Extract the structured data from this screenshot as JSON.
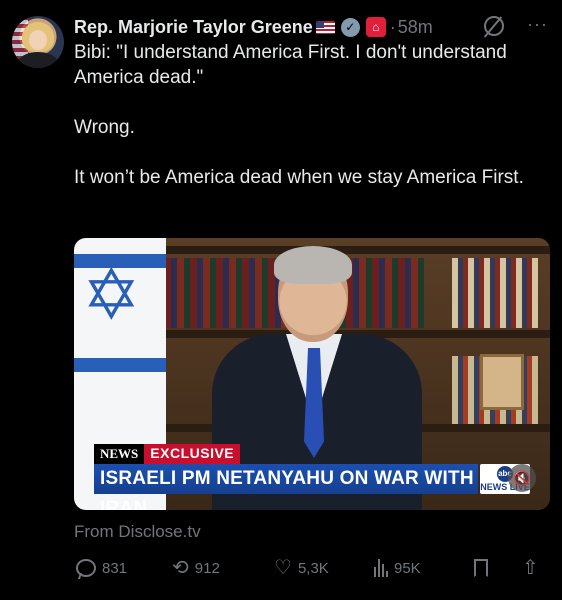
{
  "post": {
    "author_name": "Rep. Marjorie Taylor Greene",
    "timestamp_separator": "·",
    "time_ago": "58m",
    "paragraphs": [
      "Bibi: \"I understand America First. I don't understand America dead.\"",
      "Wrong.",
      "It won’t be America dead when we stay America First."
    ],
    "source": "From Disclose.tv"
  },
  "media": {
    "network_tag": "NEWS",
    "exclusive_tag": "EXCLUSIVE",
    "headline": "ISRAELI PM NETANYAHU ON WAR WITH IRAN",
    "logo_top": "abc",
    "logo_bottom": "NEWS LIVE"
  },
  "actions": {
    "replies": "831",
    "reposts": "912",
    "likes": "5,3K",
    "views": "95K"
  },
  "icons": {
    "flag": "us-flag-icon",
    "verified": "verified-badge-icon",
    "affiliation": "government-capitol-icon",
    "grok": "grok-icon",
    "more": "more-icon",
    "reply": "reply-icon",
    "repost": "repost-icon",
    "like": "heart-icon",
    "views": "views-icon",
    "bookmark": "bookmark-icon",
    "share": "share-icon",
    "mute": "mute-icon"
  },
  "colors": {
    "background": "#000000",
    "text_primary": "#e7e9ea",
    "text_secondary": "#71767b",
    "verified": "#829aab",
    "affiliation_badge": "#e0203a",
    "headline_bar": "#1b4fb0",
    "exclusive": "#c8102e"
  }
}
